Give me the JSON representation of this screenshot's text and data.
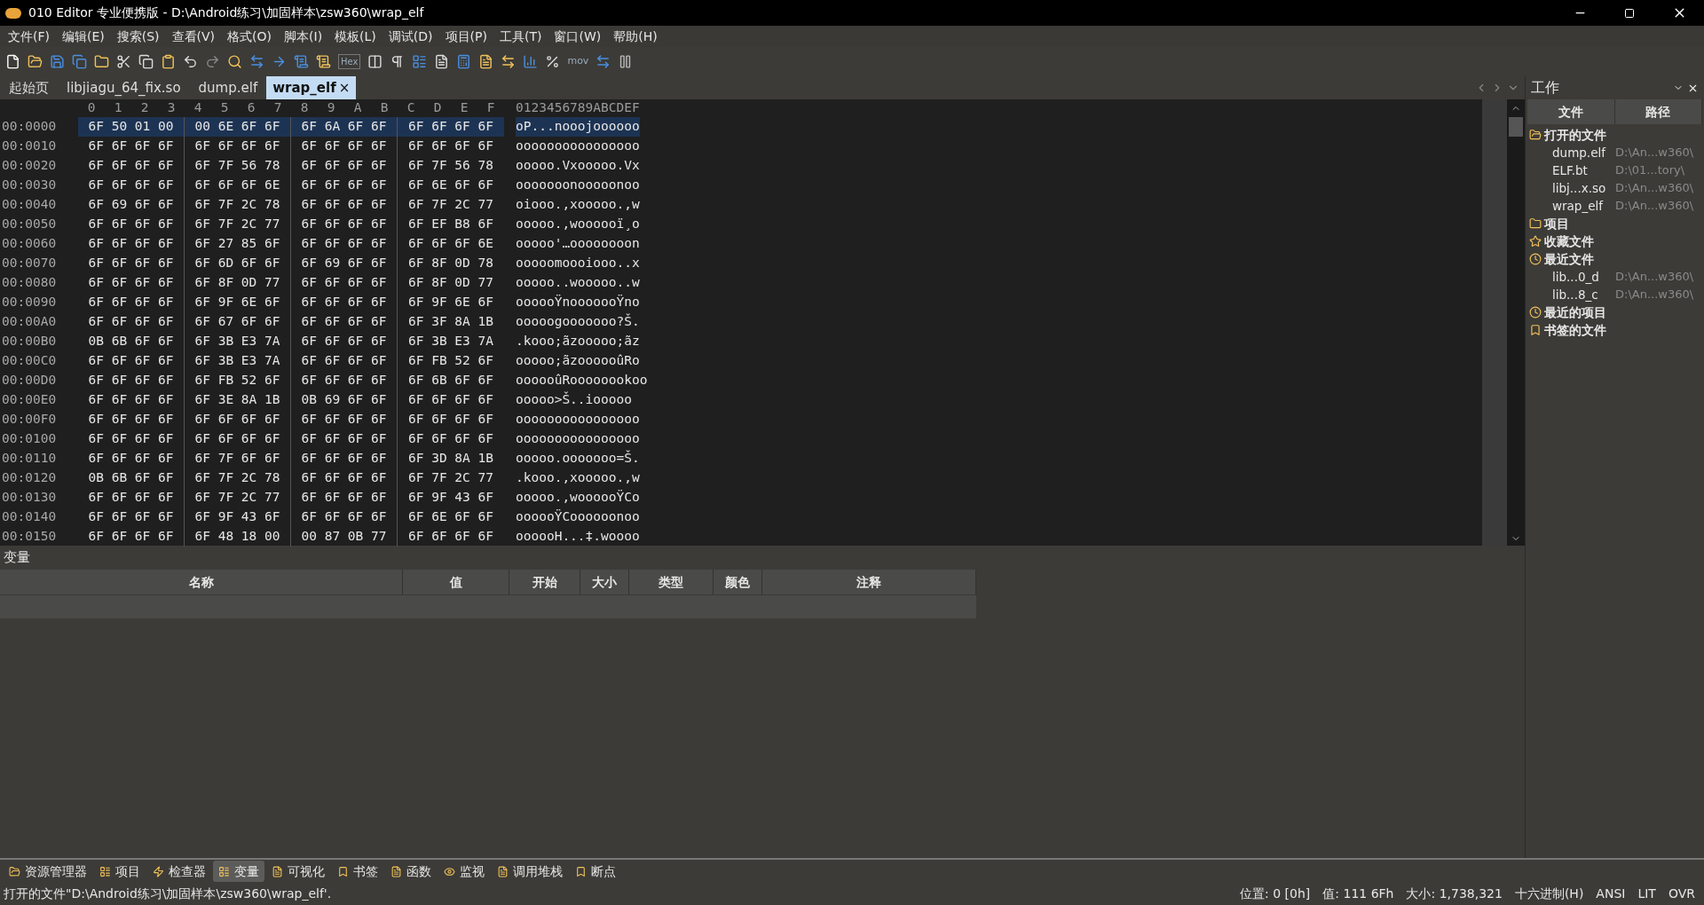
{
  "window": {
    "title": "010 Editor 专业便携版 - D:\\Android练习\\加固样本\\zsw360\\wrap_elf"
  },
  "menu": [
    "文件(F)",
    "编辑(E)",
    "搜索(S)",
    "查看(V)",
    "格式(O)",
    "脚本(I)",
    "模板(L)",
    "调试(D)",
    "项目(P)",
    "工具(T)",
    "窗口(W)",
    "帮助(H)"
  ],
  "toolbar_text": [
    "Hex",
    "mov"
  ],
  "tabs": [
    {
      "label": "起始页",
      "selected": false
    },
    {
      "label": "libjiagu_64_fix.so",
      "selected": false
    },
    {
      "label": "dump.elf",
      "selected": false
    },
    {
      "label": "wrap_elf",
      "selected": true
    }
  ],
  "tab_close": "×",
  "hex": {
    "columns": [
      "0",
      "1",
      "2",
      "3",
      "4",
      "5",
      "6",
      "7",
      "8",
      "9",
      "A",
      "B",
      "C",
      "D",
      "E",
      "F"
    ],
    "ascii_header": "0123456789ABCDEF",
    "rows": [
      {
        "offset": "00:0000",
        "bytes": [
          "6F 50 01 00",
          "00 6E 6F 6F",
          "6F 6A 6F 6F",
          "6F 6F 6F 6F"
        ],
        "ascii": "oP...nooojoooooo",
        "selected": true
      },
      {
        "offset": "00:0010",
        "bytes": [
          "6F 6F 6F 6F",
          "6F 6F 6F 6F",
          "6F 6F 6F 6F",
          "6F 6F 6F 6F"
        ],
        "ascii": "oooooooooooooooo",
        "selected": false
      },
      {
        "offset": "00:0020",
        "bytes": [
          "6F 6F 6F 6F",
          "6F 7F 56 78",
          "6F 6F 6F 6F",
          "6F 7F 56 78"
        ],
        "ascii": "ooooo.Vxooooo.Vx",
        "selected": false
      },
      {
        "offset": "00:0030",
        "bytes": [
          "6F 6F 6F 6F",
          "6F 6F 6F 6E",
          "6F 6F 6F 6F",
          "6F 6E 6F 6F"
        ],
        "ascii": "ooooooonooooonoo",
        "selected": false
      },
      {
        "offset": "00:0040",
        "bytes": [
          "6F 69 6F 6F",
          "6F 7F 2C 78",
          "6F 6F 6F 6F",
          "6F 7F 2C 77"
        ],
        "ascii": "oiooo.,xooooo.,w",
        "selected": false
      },
      {
        "offset": "00:0050",
        "bytes": [
          "6F 6F 6F 6F",
          "6F 7F 2C 77",
          "6F 6F 6F 6F",
          "6F EF B8 6F"
        ],
        "ascii": "ooooo.,woooooï¸o",
        "selected": false
      },
      {
        "offset": "00:0060",
        "bytes": [
          "6F 6F 6F 6F",
          "6F 27 85 6F",
          "6F 6F 6F 6F",
          "6F 6F 6F 6E"
        ],
        "ascii": "ooooo'…oooooooon",
        "selected": false
      },
      {
        "offset": "00:0070",
        "bytes": [
          "6F 6F 6F 6F",
          "6F 6D 6F 6F",
          "6F 69 6F 6F",
          "6F 8F 0D 78"
        ],
        "ascii": "ooooomoooiooo..x",
        "selected": false
      },
      {
        "offset": "00:0080",
        "bytes": [
          "6F 6F 6F 6F",
          "6F 8F 0D 77",
          "6F 6F 6F 6F",
          "6F 8F 0D 77"
        ],
        "ascii": "ooooo..wooooo..w",
        "selected": false
      },
      {
        "offset": "00:0090",
        "bytes": [
          "6F 6F 6F 6F",
          "6F 9F 6E 6F",
          "6F 6F 6F 6F",
          "6F 9F 6E 6F"
        ],
        "ascii": "oooooŸnooooooŸno",
        "selected": false
      },
      {
        "offset": "00:00A0",
        "bytes": [
          "6F 6F 6F 6F",
          "6F 67 6F 6F",
          "6F 6F 6F 6F",
          "6F 3F 8A 1B"
        ],
        "ascii": "ooooogooooooo?Š.",
        "selected": false
      },
      {
        "offset": "00:00B0",
        "bytes": [
          "0B 6B 6F 6F",
          "6F 3B E3 7A",
          "6F 6F 6F 6F",
          "6F 3B E3 7A"
        ],
        "ascii": ".kooo;ãzooooo;ãz",
        "selected": false
      },
      {
        "offset": "00:00C0",
        "bytes": [
          "6F 6F 6F 6F",
          "6F 3B E3 7A",
          "6F 6F 6F 6F",
          "6F FB 52 6F"
        ],
        "ascii": "ooooo;ãzoooooûRo",
        "selected": false
      },
      {
        "offset": "00:00D0",
        "bytes": [
          "6F 6F 6F 6F",
          "6F FB 52 6F",
          "6F 6F 6F 6F",
          "6F 6B 6F 6F"
        ],
        "ascii": "oooooûRoooooookoo",
        "selected": false
      },
      {
        "offset": "00:00E0",
        "bytes": [
          "6F 6F 6F 6F",
          "6F 3E 8A 1B",
          "0B 69 6F 6F",
          "6F 6F 6F 6F"
        ],
        "ascii": "ooooo>Š..iooooo",
        "selected": false
      },
      {
        "offset": "00:00F0",
        "bytes": [
          "6F 6F 6F 6F",
          "6F 6F 6F 6F",
          "6F 6F 6F 6F",
          "6F 6F 6F 6F"
        ],
        "ascii": "oooooooooooooooo",
        "selected": false
      },
      {
        "offset": "00:0100",
        "bytes": [
          "6F 6F 6F 6F",
          "6F 6F 6F 6F",
          "6F 6F 6F 6F",
          "6F 6F 6F 6F"
        ],
        "ascii": "oooooooooooooooo",
        "selected": false
      },
      {
        "offset": "00:0110",
        "bytes": [
          "6F 6F 6F 6F",
          "6F 7F 6F 6F",
          "6F 6F 6F 6F",
          "6F 3D 8A 1B"
        ],
        "ascii": "ooooo.ooooooo=Š.",
        "selected": false
      },
      {
        "offset": "00:0120",
        "bytes": [
          "0B 6B 6F 6F",
          "6F 7F 2C 78",
          "6F 6F 6F 6F",
          "6F 7F 2C 77"
        ],
        "ascii": ".kooo.,xooooo.,w",
        "selected": false
      },
      {
        "offset": "00:0130",
        "bytes": [
          "6F 6F 6F 6F",
          "6F 7F 2C 77",
          "6F 6F 6F 6F",
          "6F 9F 43 6F"
        ],
        "ascii": "ooooo.,woooooŸCo",
        "selected": false
      },
      {
        "offset": "00:0140",
        "bytes": [
          "6F 6F 6F 6F",
          "6F 9F 43 6F",
          "6F 6F 6F 6F",
          "6F 6E 6F 6F"
        ],
        "ascii": "oooooŸCoooooonoo",
        "selected": false
      },
      {
        "offset": "00:0150",
        "bytes": [
          "6F 6F 6F 6F",
          "6F 48 18 00",
          "00 87 0B 77",
          "6F 6F 6F 6F"
        ],
        "ascii": "oooooH...‡.woooo",
        "selected": false
      }
    ]
  },
  "workspace": {
    "title": "工作",
    "columns": [
      "文件",
      "路径"
    ],
    "tree": [
      {
        "label": "打开的文件",
        "children": [
          {
            "label": "dump.elf",
            "path": "D:\\An...w360\\"
          },
          {
            "label": "ELF.bt",
            "path": "D:\\01...tory\\"
          },
          {
            "label": "libj...x.so",
            "path": "D:\\An...w360\\"
          },
          {
            "label": "wrap_elf",
            "path": "D:\\An...w360\\"
          }
        ]
      },
      {
        "label": "项目"
      },
      {
        "label": "收藏文件"
      },
      {
        "label": "最近文件",
        "children": [
          {
            "label": "lib...0_d",
            "path": "D:\\An...w360\\"
          },
          {
            "label": "lib...8_c",
            "path": "D:\\An...w360\\"
          }
        ]
      },
      {
        "label": "最近的项目"
      },
      {
        "label": "书签的文件"
      }
    ]
  },
  "variables": {
    "title": "变量",
    "columns": [
      "名称",
      "值",
      "开始",
      "大小",
      "类型",
      "颜色",
      "注释"
    ]
  },
  "bottom_tabs": [
    {
      "label": "资源管理器",
      "selected": false
    },
    {
      "label": "项目",
      "selected": false
    },
    {
      "label": "检查器",
      "selected": false
    },
    {
      "label": "变量",
      "selected": true
    },
    {
      "label": "可视化",
      "selected": false
    },
    {
      "label": "书签",
      "selected": false
    },
    {
      "label": "函数",
      "selected": false
    },
    {
      "label": "监视",
      "selected": false
    },
    {
      "label": "调用堆栈",
      "selected": false
    },
    {
      "label": "断点",
      "selected": false
    }
  ],
  "status_bar": {
    "message": "打开的文件\"D:\\Android练习\\加固样本\\zsw360\\wrap_elf'.",
    "fields": [
      "位置: 0 [0h]",
      "值: 111 6Fh",
      "大小: 1,738,321",
      "十六进制(H)",
      "ANSI",
      "LIT",
      "OVR"
    ]
  }
}
